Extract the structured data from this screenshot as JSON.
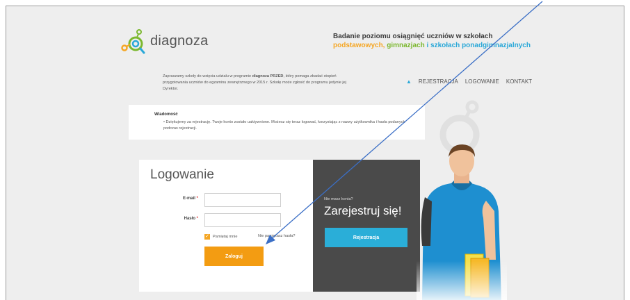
{
  "brand": {
    "name": "diagnoza"
  },
  "tagline": {
    "line1": "Badanie poziomu osiągnięć uczniów w szkołach",
    "part_primary": "podstawowych,",
    "part_middle": "gimnazjach",
    "part_connector": "i",
    "part_secondary": "szkołach ponadgimnazjalnych",
    "colors": {
      "primary": "#f5a623",
      "middle": "#7cb82f",
      "secondary": "#2aa8d8"
    }
  },
  "intro": {
    "text_before": "Zapraszamy szkoły do wzięcia udziału w programie",
    "program": "diagnoza PRZED",
    "text_after": ", który pomaga zbadać stopień przygotowania uczniów do egzaminu zewnętrznego w 2015 r. Szkołę może zgłosić do programu jedynie jej Dyrektor."
  },
  "nav": {
    "home_icon": "home-icon",
    "items": [
      "REJESTRACJA",
      "LOGOWANIE",
      "KONTAKT"
    ]
  },
  "message": {
    "title": "Wiadomość",
    "text": "Dziękujemy za rejestrację. Twoje konto zostało uaktywnione. Możesz się teraz logować, korzystając z nazwy użytkownika i hasła podanych podczas rejestracji."
  },
  "login": {
    "heading": "Logowanie",
    "email_label": "E-mail",
    "password_label": "Hasło",
    "required_mark": "*",
    "email_value": "",
    "password_value": "",
    "remember_label": "Pamiętaj mnie",
    "remember_checked": true,
    "forgot_label": "Nie pamiętasz hasła?",
    "submit_label": "Zaloguj",
    "accent": "#f39c12"
  },
  "register": {
    "question": "Nie masz konta?",
    "headline": "Zarejestruj się!",
    "button_label": "Rejestracja",
    "accent": "#2aaed8"
  }
}
